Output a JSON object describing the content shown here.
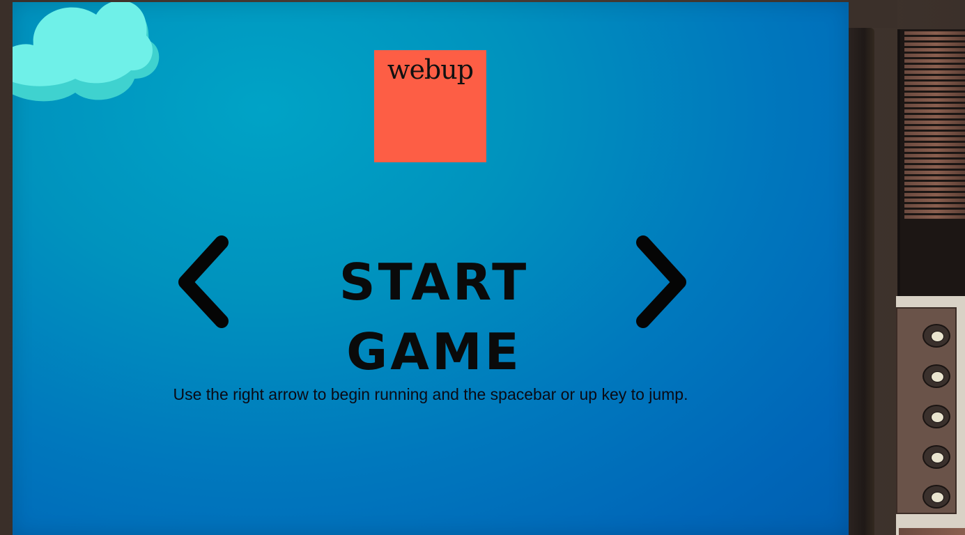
{
  "logo": {
    "text": "webup",
    "color": "#fd5e45"
  },
  "menu": {
    "start_label": "START GAME",
    "left_arrow_icon": "chevron-left-icon",
    "right_arrow_icon": "chevron-right-icon"
  },
  "instructions": "Use the right arrow to begin running and the spacebar or up key to jump.",
  "colors": {
    "sky_top": "#00a3c6",
    "sky_bottom": "#005fb0",
    "cloud": "#6ff0e8",
    "cloud_shadow": "#3fd2cf"
  },
  "tv_panel": {
    "knob_count": 5
  }
}
